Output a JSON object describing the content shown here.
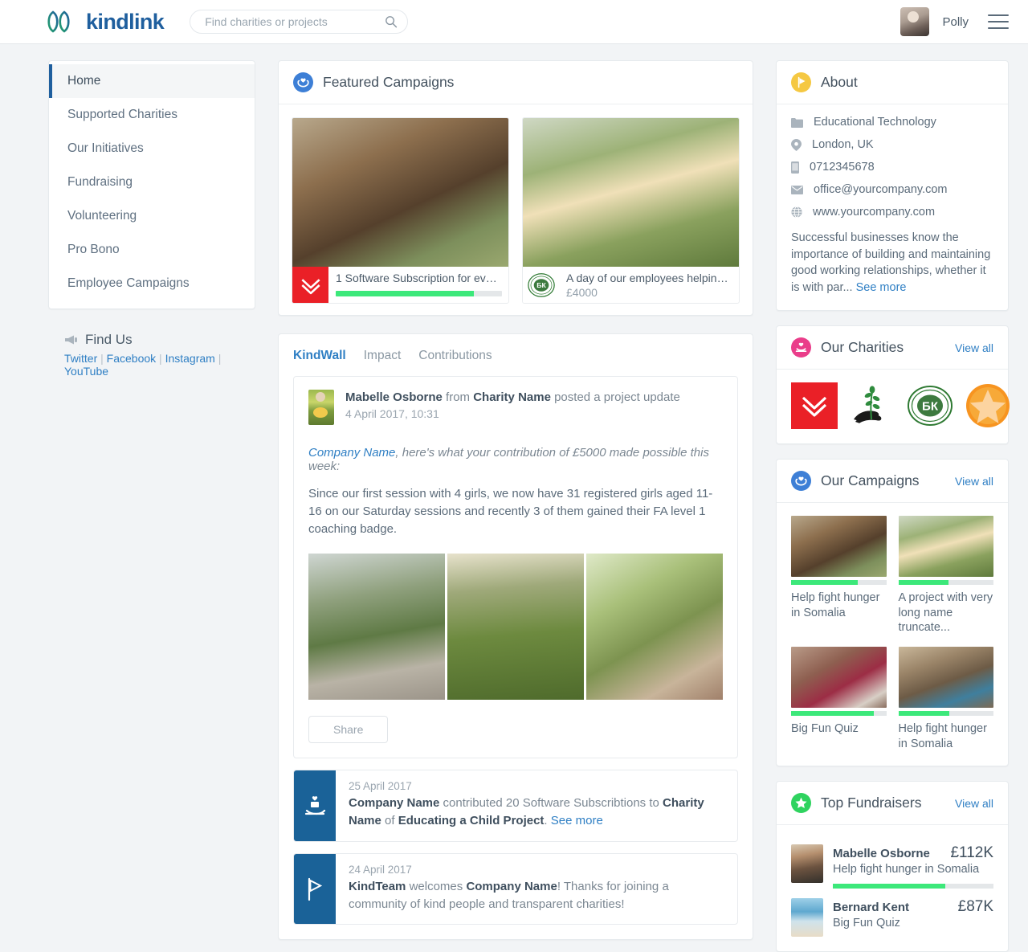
{
  "header": {
    "brand": "kindlink",
    "search_placeholder": "Find charities or projects",
    "user_name": "Polly"
  },
  "sidebar": {
    "items": [
      {
        "label": "Home",
        "active": true
      },
      {
        "label": "Supported Charities",
        "active": false
      },
      {
        "label": "Our Initiatives",
        "active": false
      },
      {
        "label": "Fundraising",
        "active": false
      },
      {
        "label": "Volunteering",
        "active": false
      },
      {
        "label": "Pro Bono",
        "active": false
      },
      {
        "label": "Employee Campaigns",
        "active": false
      }
    ],
    "find_us": {
      "title": "Find Us",
      "links": [
        "Twitter",
        "Facebook",
        "Instagram",
        "YouTube"
      ],
      "separator": "|"
    }
  },
  "featured": {
    "title": "Featured Campaigns",
    "cards": [
      {
        "title": "1 Software Subscription for every...",
        "amount": "",
        "progress": 83,
        "logo": "kindlink-red-logo"
      },
      {
        "title": "A day of our employees helping th...",
        "amount": "£4000",
        "progress": 0,
        "logo": "bk-green-badge"
      }
    ]
  },
  "wall": {
    "tabs": [
      {
        "label": "KindWall",
        "active": true
      },
      {
        "label": "Impact",
        "active": false
      },
      {
        "label": "Contributions",
        "active": false
      }
    ],
    "post": {
      "author": "Mabelle Osborne",
      "from_word": "from",
      "charity": "Charity Name",
      "action": "posted a project update",
      "timestamp": "4 April 2017, 10:31",
      "lede_company": "Company Name",
      "lede_rest": ", here's what your contribution of £5000 made possible this week:",
      "body": "Since our first session with 4 girls, we now have 31 registered girls aged 11-16 on our Saturday sessions and recently 3 of them gained their FA level 1 coaching badge.",
      "share_label": "Share"
    },
    "feed": [
      {
        "date": "25 April 2017",
        "icon": "donate-hand-icon",
        "segments": [
          {
            "text": "Company Name",
            "bold": true
          },
          {
            "text": " contributed 20 Software Subscribtions to ",
            "bold": false
          },
          {
            "text": "Charity Name",
            "bold": true
          },
          {
            "text": " of ",
            "bold": false
          },
          {
            "text": "Educating a Child Project",
            "bold": true
          },
          {
            "text": ". ",
            "bold": false
          }
        ],
        "link": "See more"
      },
      {
        "date": "24 April 2017",
        "icon": "flag-icon",
        "segments": [
          {
            "text": "KindTeam",
            "bold": true
          },
          {
            "text": " welcomes ",
            "bold": false
          },
          {
            "text": "Company Name",
            "bold": true
          },
          {
            "text": "! Thanks for joining a community of kind people and transparent charities!",
            "bold": false
          }
        ],
        "link": ""
      }
    ]
  },
  "about": {
    "title": "About",
    "industry": "Educational Technology",
    "location": "London, UK",
    "phone": "0712345678",
    "email": "office@yourcompany.com",
    "website": "www.yourcompany.com",
    "description": "Successful businesses know the importance of building and maintaining good working relationships, whether it is with par...",
    "see_more": "See more"
  },
  "charities": {
    "title": "Our Charities",
    "view_all": "View all",
    "logos": [
      "kindlink-red-logo",
      "hand-plant-logo",
      "bk-green-badge",
      "orange-starfish-logo"
    ]
  },
  "campaigns": {
    "title": "Our Campaigns",
    "view_all": "View all",
    "items": [
      {
        "title": "Help fight hunger in Somalia",
        "progress": 70,
        "photo": "child-hug"
      },
      {
        "title": "A project with very long name truncate...",
        "progress": 53,
        "photo": "baby-shoes"
      },
      {
        "title": "Big Fun Quiz",
        "progress": 87,
        "photo": "quiz-men"
      },
      {
        "title": "Help fight hunger in Somalia",
        "progress": 54,
        "photo": "shelter"
      }
    ]
  },
  "fundraisers": {
    "title": "Top Fundraisers",
    "view_all": "View all",
    "items": [
      {
        "name": "Mabelle Osborne",
        "campaign": "Help fight hunger in Somalia",
        "amount": "£112K",
        "progress": 70,
        "photo": "woman-portrait"
      },
      {
        "name": "Bernard Kent",
        "campaign": "Big Fun Quiz",
        "amount": "£87K",
        "progress": 0,
        "photo": "beach"
      }
    ]
  },
  "colors": {
    "brand_blue": "#1f5f9e",
    "link_blue": "#2f7fc4",
    "progress_green": "#3ce87a",
    "about_yellow": "#f5c842",
    "charities_pink": "#ea3d8a",
    "campaigns_blue": "#3d7fd6",
    "fundraisers_green": "#2fd35f",
    "charity_red": "#ea2027"
  }
}
